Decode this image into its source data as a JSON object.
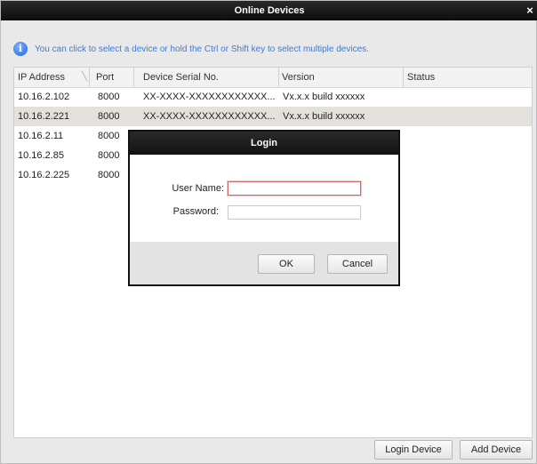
{
  "window": {
    "title": "Online Devices",
    "close_glyph": "×"
  },
  "hint": {
    "icon": "info-icon",
    "icon_glyph": "i",
    "text": "You can click to select a device or hold the Ctrl or Shift key to select multiple devices."
  },
  "table": {
    "columns": [
      "IP Address",
      "Port",
      "Device Serial No.",
      "Version",
      "Status"
    ],
    "rows": [
      {
        "ip": "10.16.2.102",
        "port": "8000",
        "serial": "XX-XXXX-XXXXXXXXXXXX...",
        "version": "Vx.x.x build xxxxxx",
        "status": "",
        "selected": false
      },
      {
        "ip": "10.16.2.221",
        "port": "8000",
        "serial": "XX-XXXX-XXXXXXXXXXXX...",
        "version": "Vx.x.x build xxxxxx",
        "status": "",
        "selected": true
      },
      {
        "ip": "10.16.2.11",
        "port": "8000",
        "serial": "",
        "version": "",
        "status": "",
        "selected": false
      },
      {
        "ip": "10.16.2.85",
        "port": "8000",
        "serial": "",
        "version": "",
        "status": "",
        "selected": false
      },
      {
        "ip": "10.16.2.225",
        "port": "8000",
        "serial": "",
        "version": "",
        "status": "",
        "selected": false
      }
    ]
  },
  "buttons": {
    "login_device": "Login Device",
    "add_device": "Add Device"
  },
  "login_dialog": {
    "title": "Login",
    "username_label": "User Name:",
    "username_value": "",
    "password_label": "Password:",
    "password_value": "",
    "ok_label": "OK",
    "cancel_label": "Cancel"
  },
  "colors": {
    "titlebar": "#111111",
    "hint_text": "#3c7bd6",
    "selected_row": "#e4e0db",
    "active_input_border": "#d06b6b"
  }
}
